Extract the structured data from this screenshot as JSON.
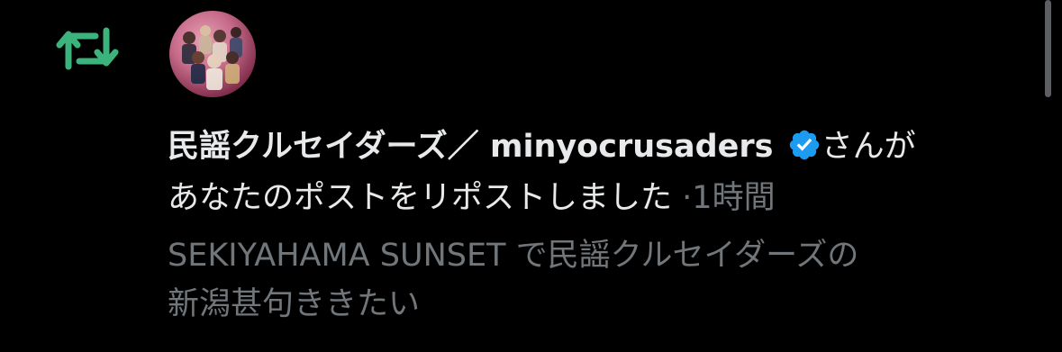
{
  "notification": {
    "type_icon": "repost-icon",
    "avatar_icon": "avatar",
    "author_name": "民謡クルセイダーズ／ minyocrusaders",
    "verified_icon": "verified-badge-icon",
    "headline_suffix": "さんが",
    "action_text": "あなたのポストをリポストしました",
    "separator": "·",
    "time": "1時間",
    "post_preview_line1": "SEKIYAHAMA SUNSET で民謡クルセイダーズの",
    "post_preview_line2": "新潟甚句ききたい"
  },
  "colors": {
    "background": "#000000",
    "primary_text": "#e7e9ea",
    "secondary_text": "#71767b",
    "repost_green": "#00ba7c",
    "verified_blue": "#1d9bf0"
  }
}
